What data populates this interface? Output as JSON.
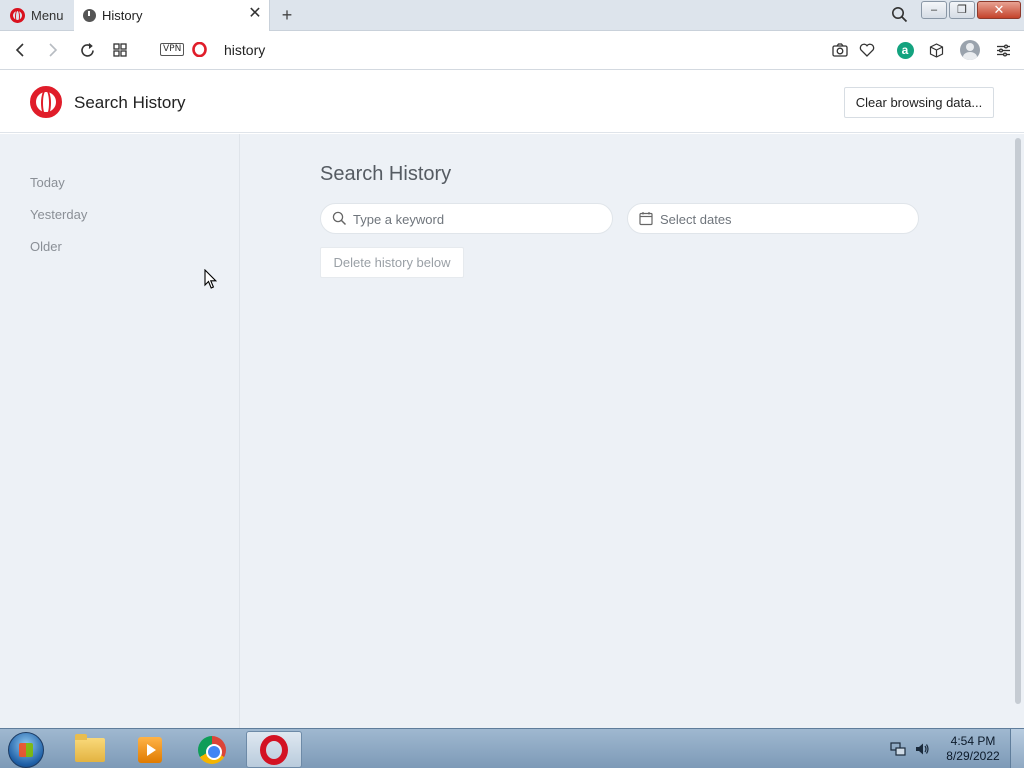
{
  "tabstrip": {
    "menu_label": "Menu",
    "tab_title": "History",
    "new_tab_symbol": "+",
    "close_symbol": "✕"
  },
  "window_buttons": {
    "minimize": "–",
    "restore": "❐",
    "close": "✕"
  },
  "address_bar": {
    "vpn_label": "VPN",
    "url": "history"
  },
  "header": {
    "title": "Search History",
    "clear_button": "Clear browsing data..."
  },
  "sidebar": {
    "items": [
      {
        "label": "Today"
      },
      {
        "label": "Yesterday"
      },
      {
        "label": "Older"
      }
    ]
  },
  "main": {
    "title": "Search History",
    "search_placeholder": "Type a keyword",
    "date_placeholder": "Select dates",
    "delete_button": "Delete history below"
  },
  "taskbar": {
    "apps": [
      "windows-explorer",
      "media-player",
      "chrome",
      "opera"
    ],
    "time": "4:54 PM",
    "date": "8/29/2022"
  },
  "colors": {
    "opera_red": "#e01d2a",
    "page_background": "#edf1f6",
    "aria_green": "#14a37f"
  }
}
